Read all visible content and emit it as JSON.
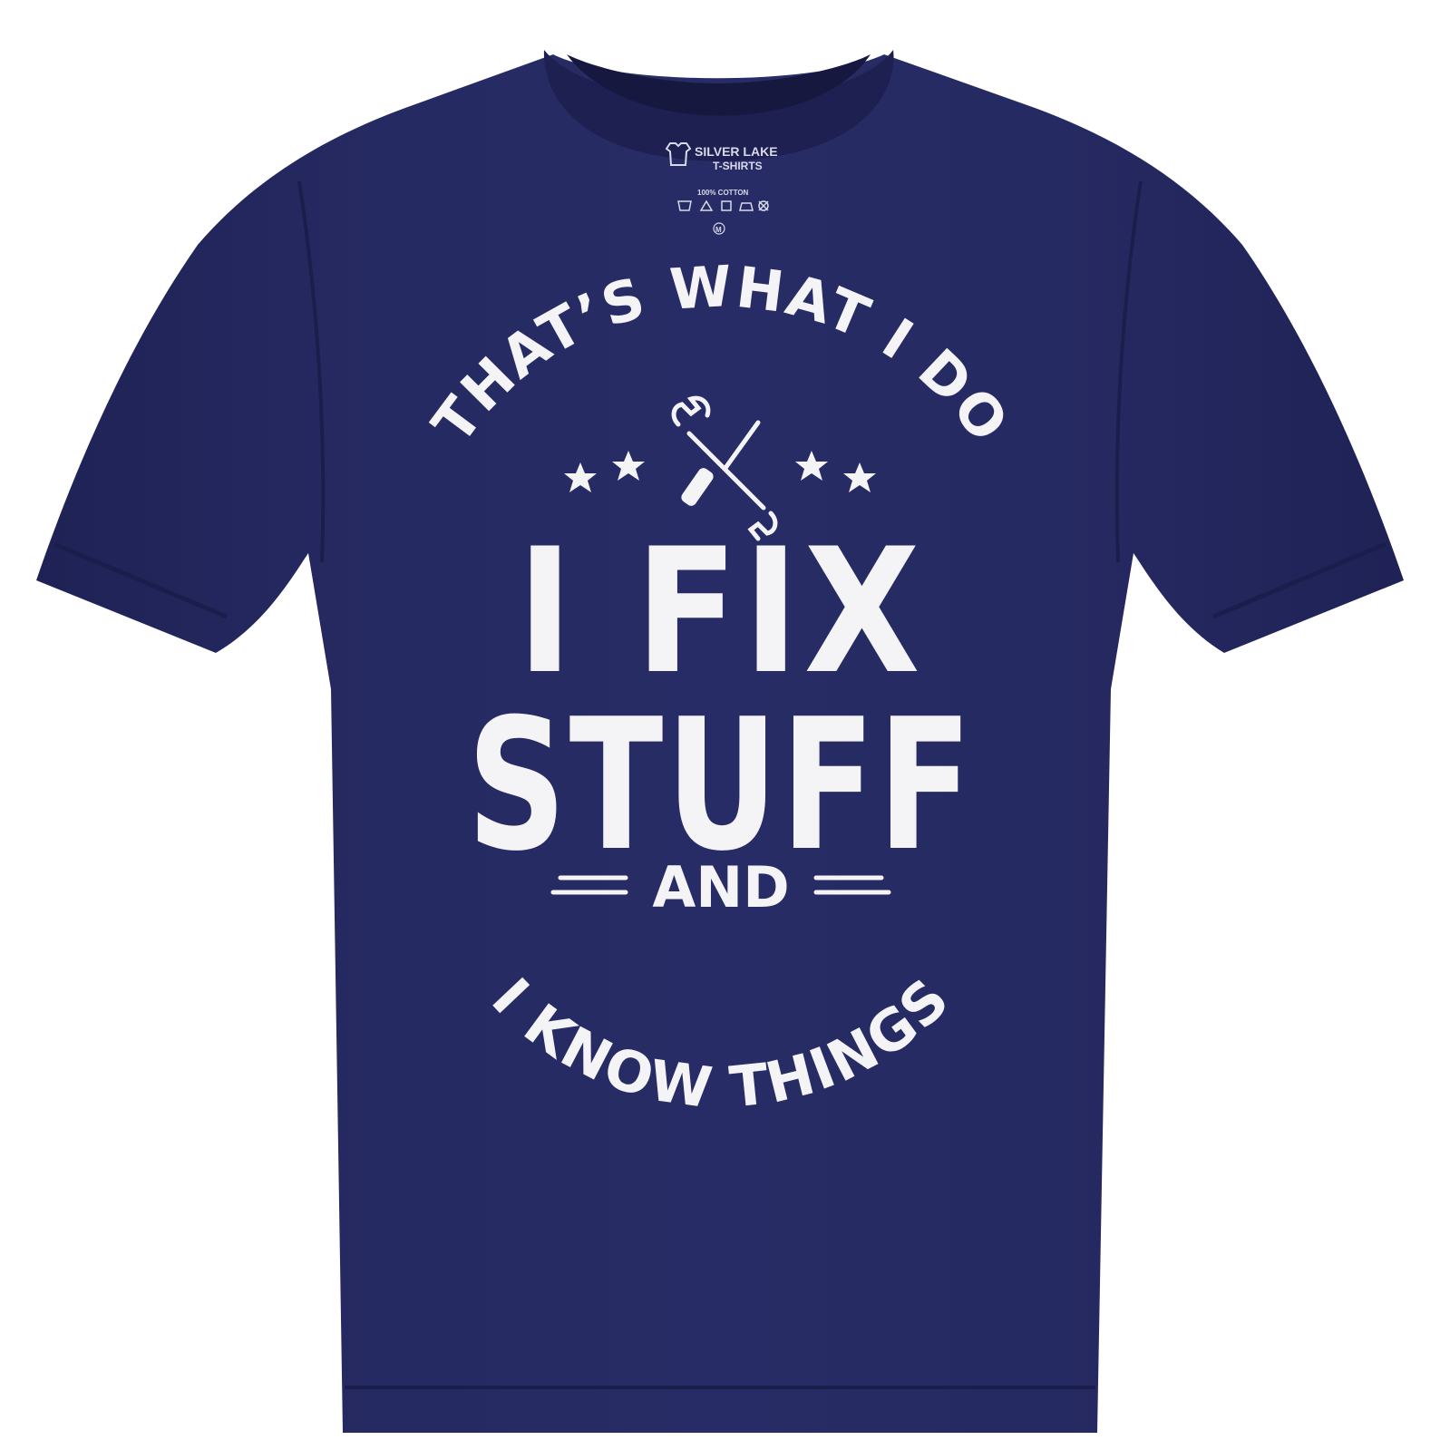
{
  "shirt": {
    "color": "#25285e",
    "shade_color": "#1c1f4d",
    "highlight_color": "#2e3270"
  },
  "label": {
    "brand_line1": "SILVER LAKE",
    "brand_line2": "T-SHIRTS",
    "material": "100% COTTON",
    "size": "M",
    "icons": [
      "shirt-logo-icon",
      "wash-30-icon",
      "bleach-icon",
      "dryer-icon",
      "iron-icon",
      "dry-clean-icon"
    ]
  },
  "print": {
    "arc_top": "THAT’S WHAT I DO",
    "line1": "I FIX",
    "line2": "STUFF",
    "line3": "AND",
    "arc_bottom": "I KNOW THINGS",
    "ink_color": "#f4f4f6",
    "icons": [
      "wrench-icon",
      "screwdriver-icon",
      "star-icon"
    ]
  }
}
